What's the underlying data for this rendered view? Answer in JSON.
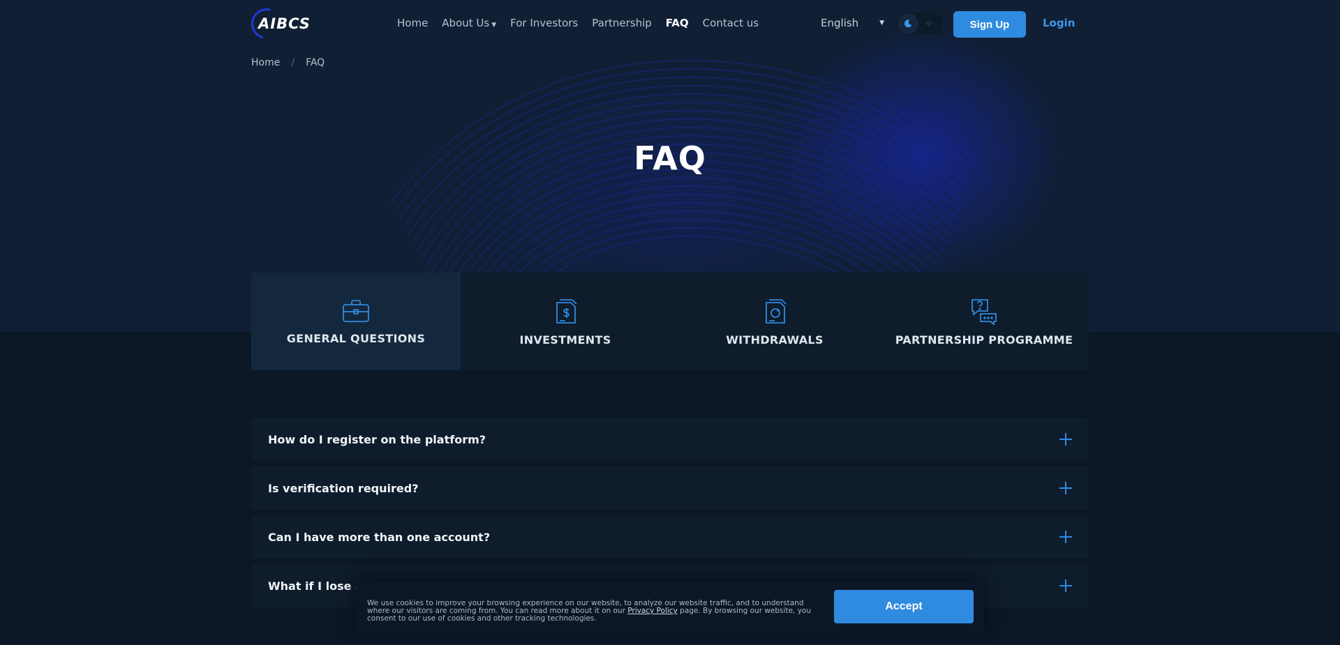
{
  "header": {
    "logo_text": "AIBCS",
    "nav": [
      {
        "label": "Home"
      },
      {
        "label": "About Us"
      },
      {
        "label": "For Investors"
      },
      {
        "label": "Partnership"
      },
      {
        "label": "FAQ",
        "active": true
      },
      {
        "label": "Contact us"
      }
    ],
    "language": "English",
    "signup_label": "Sign Up",
    "login_label": "Login"
  },
  "breadcrumb": {
    "home": "Home",
    "separator": "/",
    "current": "FAQ"
  },
  "page_title": "FAQ",
  "tabs": [
    {
      "label": "GENERAL QUESTIONS",
      "icon": "briefcase-icon",
      "active": true
    },
    {
      "label": "INVESTMENTS",
      "icon": "document-dollar-icon"
    },
    {
      "label": "WITHDRAWALS",
      "icon": "document-refresh-icon"
    },
    {
      "label": "PARTNERSHIP PROGRAMME",
      "icon": "chat-question-icon"
    }
  ],
  "faq": [
    {
      "question": "How do I register on the platform?"
    },
    {
      "question": "Is verification required?"
    },
    {
      "question": "Can I have more than one account?"
    },
    {
      "question": "What if I lose a"
    }
  ],
  "cookie": {
    "text_before": "We use cookies to improve your browsing experience on our website, to analyze our website traffic, and to understand where our visitors are coming from. You can read more about it on our ",
    "link": "Privacy Policy",
    "text_after": " page. By browsing our website, you consent to our use of cookies and other tracking technologies.",
    "accept_label": "Accept"
  },
  "colors": {
    "accent": "#2f8be0",
    "background": "#0b1725",
    "panel": "#0f1c2c"
  }
}
